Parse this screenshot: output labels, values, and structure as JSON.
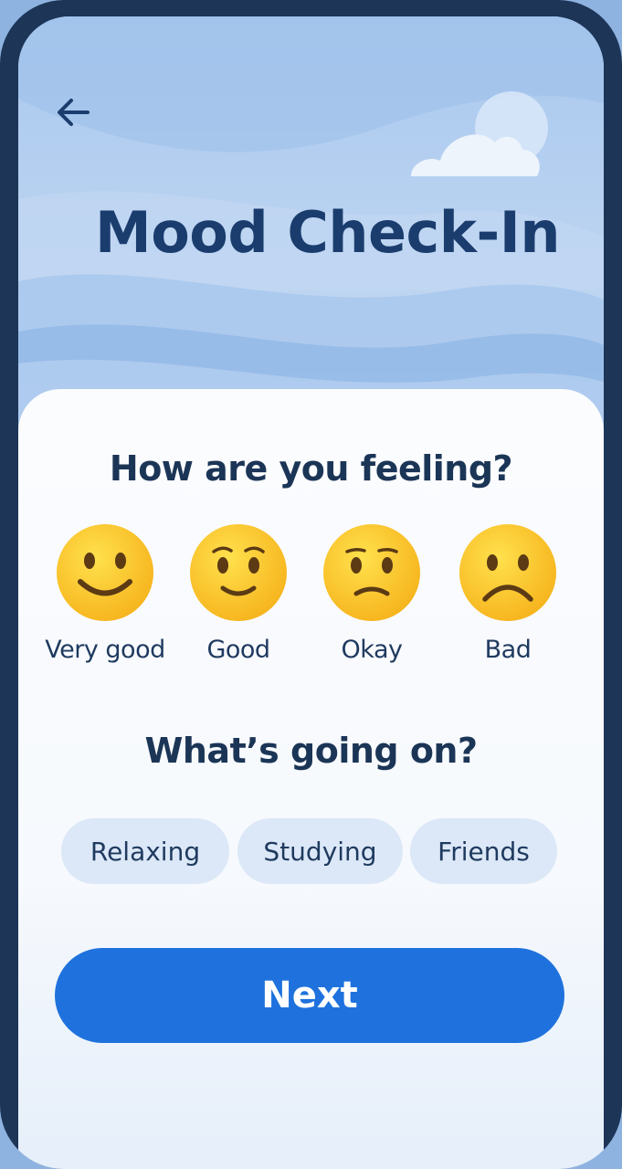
{
  "header": {
    "back_icon": "arrow-left-icon",
    "title": "Mood Check-In"
  },
  "mood_section": {
    "question": "How are you feeling?",
    "options": [
      {
        "label": "Very good",
        "icon": "smiling-face-icon"
      },
      {
        "label": "Good",
        "icon": "slightly-smiling-face-icon"
      },
      {
        "label": "Okay",
        "icon": "slightly-frowning-face-icon"
      },
      {
        "label": "Bad",
        "icon": "frowning-face-icon"
      }
    ]
  },
  "activity_section": {
    "question": "What’s going on?",
    "chips": [
      {
        "label": "Relaxing"
      },
      {
        "label": "Studying"
      },
      {
        "label": "Friends"
      }
    ]
  },
  "footer": {
    "next_label": "Next"
  },
  "colors": {
    "accent": "#1f72dd",
    "title_text": "#1b3d6e",
    "chip_background": "#dce8f7",
    "frame": "#1d3557"
  }
}
